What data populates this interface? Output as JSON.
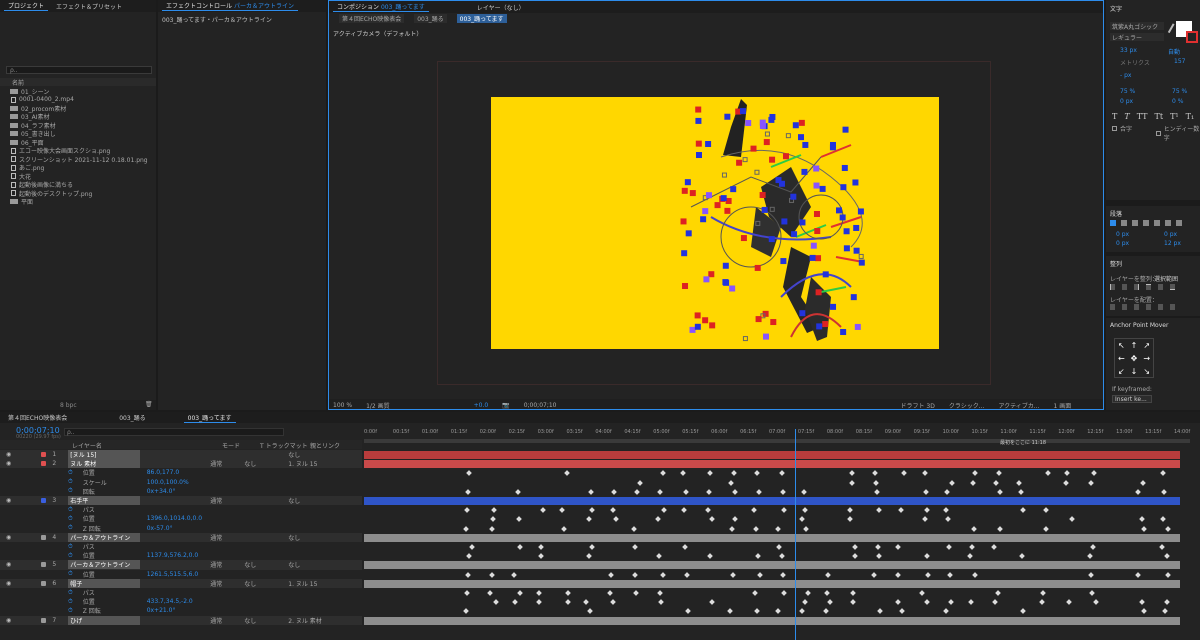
{
  "project_panel": {
    "tabs": [
      "プロジェクト",
      "エフェクト＆プリセット"
    ],
    "search_placeholder": "ρ..",
    "column_name": "名前",
    "items": [
      {
        "name": "01_シーン",
        "type": "folder"
      },
      {
        "name": "0001-0400_2.mp4",
        "type": "file"
      },
      {
        "name": "02_procom素材",
        "type": "folder"
      },
      {
        "name": "03_AI素材",
        "type": "folder"
      },
      {
        "name": "04_ラフ素材",
        "type": "folder"
      },
      {
        "name": "05_書き出し",
        "type": "folder"
      },
      {
        "name": "06_平面",
        "type": "folder"
      },
      {
        "name": "エコー映像大会画面スクショ.png",
        "type": "file"
      },
      {
        "name": "スクリーンショット 2021-11-12 0.18.01.png",
        "type": "file"
      },
      {
        "name": "あご.png",
        "type": "file"
      },
      {
        "name": "大花",
        "type": "file"
      },
      {
        "name": "起動後画像に満ちる",
        "type": "file"
      },
      {
        "name": "起動後のデスクトップ.png",
        "type": "file"
      },
      {
        "name": "平面",
        "type": "folder"
      }
    ],
    "bit_depth": "8 bpc"
  },
  "effect_controls": {
    "tab_label": "エフェクトコントロール",
    "tab_layer": "パーカ＆アウトライン",
    "breadcrumb": "003_踊ってます・パーカ＆アウトライン"
  },
  "composition_panel": {
    "tab_label": "コンポジション",
    "tab_comp": "003_踊ってます",
    "layer_tab": "レイヤー（なし）",
    "breadcrumbs": [
      "第４回ECHO映像表会",
      "003_踊る",
      "003_踊ってます"
    ],
    "camera_label": "アクティブカメラ（デフォルト）",
    "bg_color": "#ffd700",
    "footer": {
      "zoom": "100 %",
      "quality": "1/2 画質",
      "exposure": "+0.0",
      "timecode": "0;00;07;10",
      "draft3d": "ドラフト 3D",
      "renderer": "クラシック...",
      "camera": "アクティブカ...",
      "views": "1 画面"
    }
  },
  "character_panel": {
    "title": "文字",
    "font": "筑紫A丸ゴシック",
    "style": "レギュラー",
    "size": "33 px",
    "leading": "自動",
    "tracking_label": "メトリクス",
    "tracking": "157",
    "stroke": "- px",
    "vscale": "75 %",
    "hscale": "75 %",
    "baseline": "0 px",
    "tsume": "0 %",
    "style_buttons": [
      "T",
      "T",
      "TT",
      "Tt",
      "T¹",
      "T₁"
    ],
    "checkbox_ruby": "合字",
    "checkbox_hindi": "ヒンディー数字"
  },
  "paragraph_panel": {
    "title": "段落",
    "indent_left": "0 px",
    "indent_right": "0 px",
    "space_before": "0 px",
    "space_after": "12 px",
    "first_indent": "0 px"
  },
  "align_panel": {
    "title": "整列",
    "align_to_label": "レイヤーを整列：",
    "align_to_value": "選択範囲",
    "distribute_label": "レイヤーを配置："
  },
  "anchor_panel": {
    "title": "Anchor Point Mover",
    "keyframed_label": "If keyframed:",
    "keyframed_value": "Insert ke..."
  },
  "timeline": {
    "tabs": [
      "第４回ECHO映像表会",
      "003_踊る",
      "003_踊ってます"
    ],
    "timecode": "0;00;07;10",
    "timecode_sub": "00220 (29.97 fps)",
    "search_placeholder": "ρ..",
    "col_layer_name": "レイヤー名",
    "col_mode": "モード",
    "col_track": "T トラックマット",
    "col_parent": "親とリンク",
    "ruler": [
      "0:00f",
      "00:15f",
      "01:00f",
      "01:15f",
      "02:00f",
      "02:15f",
      "03:00f",
      "03:15f",
      "04:00f",
      "04:15f",
      "05:00f",
      "05:15f",
      "06:00f",
      "06:15f",
      "07:00f",
      "07:15f",
      "08:00f",
      "08:15f",
      "09:00f",
      "09:15f",
      "10:00f",
      "10:15f",
      "11:00f",
      "11:15f",
      "12:00f",
      "12:15f",
      "13:00f",
      "13:15f",
      "14:00f"
    ],
    "marker_text": "最初をここに 11:18",
    "rows": [
      {
        "kind": "layer",
        "num": "1",
        "name": "[ヌル 15]",
        "color": "#e05050",
        "mode": "",
        "track": "",
        "parent": "なし",
        "bar": "#b93c3c"
      },
      {
        "kind": "layer",
        "num": "2",
        "name": "ヌル 素材",
        "color": "#e05050",
        "mode": "通常",
        "track": "なし",
        "parent": "1. ヌル 15",
        "bar": "#c94a4a"
      },
      {
        "kind": "prop",
        "name": "位置",
        "value": "86.0,177.0"
      },
      {
        "kind": "prop",
        "name": "スケール",
        "value": "100.0,100.0%"
      },
      {
        "kind": "prop",
        "name": "回転",
        "value": "0x+34.0°"
      },
      {
        "kind": "layer",
        "num": "3",
        "name": "右手平",
        "color": "#3a5fe0",
        "mode": "通常",
        "track": "",
        "parent": "なし",
        "bar": "#2f55c8"
      },
      {
        "kind": "prop",
        "name": "パス",
        "value": ""
      },
      {
        "kind": "prop",
        "name": "位置",
        "value": "1396.0,1014.0,0.0"
      },
      {
        "kind": "prop",
        "name": "Z 回転",
        "value": "0x-57.0°"
      },
      {
        "kind": "layer",
        "num": "4",
        "name": "パーカ＆アウトライン",
        "color": "#9a9a9a",
        "mode": "通常",
        "track": "",
        "parent": "なし",
        "bar": "#8d8d8d"
      },
      {
        "kind": "prop",
        "name": "パス",
        "value": ""
      },
      {
        "kind": "prop",
        "name": "位置",
        "value": "1137.9,576.2,0.0"
      },
      {
        "kind": "layer",
        "num": "5",
        "name": "パーカ＆アウトライン",
        "color": "#9a9a9a",
        "mode": "通常",
        "track": "なし",
        "parent": "なし",
        "bar": "#8d8d8d"
      },
      {
        "kind": "prop",
        "name": "位置",
        "value": "1261.5,515.5,6.0"
      },
      {
        "kind": "layer",
        "num": "6",
        "name": "帽子",
        "color": "#9a9a9a",
        "mode": "通常",
        "track": "なし",
        "parent": "1. ヌル 15",
        "bar": "#8d8d8d"
      },
      {
        "kind": "prop",
        "name": "パス",
        "value": ""
      },
      {
        "kind": "prop",
        "name": "位置",
        "value": "433.7,34.5,-2.0"
      },
      {
        "kind": "prop",
        "name": "Z 回転",
        "value": "0x+21.0°"
      },
      {
        "kind": "layer",
        "num": "7",
        "name": "ひげ",
        "color": "#9a9a9a",
        "mode": "通常",
        "track": "なし",
        "parent": "2. ヌル 素材",
        "bar": "#8d8d8d"
      }
    ]
  }
}
